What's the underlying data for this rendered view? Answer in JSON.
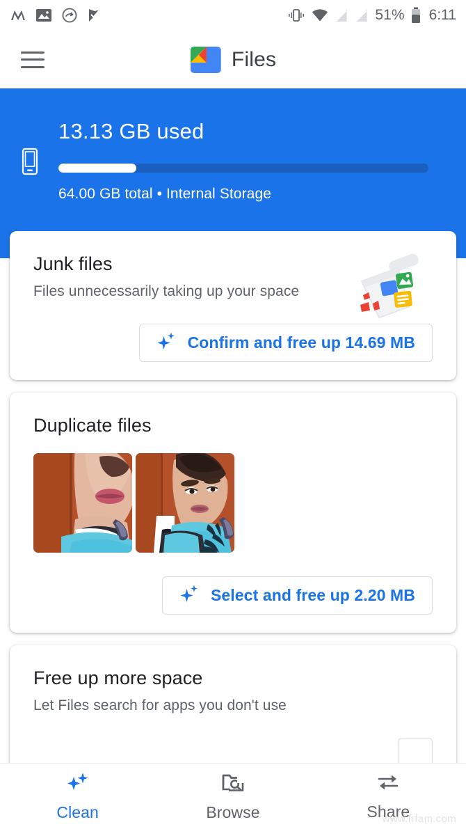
{
  "statusbar": {
    "left_icons": [
      "mountain-peaks-icon",
      "photo-icon",
      "clock-arrow-icon",
      "checkmark-flag-icon"
    ],
    "right_icons": [
      "vibrate-icon",
      "wifi-icon",
      "sim-empty-icon-1",
      "sim-empty-icon-2"
    ],
    "battery_percent": "51%",
    "battery_icon": "battery-icon",
    "time": "6:11"
  },
  "appbar": {
    "menu_icon": "hamburger-menu-icon",
    "logo_icon": "files-app-logo",
    "title": "Files"
  },
  "storage": {
    "device_icon": "phone-icon",
    "used_label": "13.13 GB used",
    "total_label": "64.00 GB total • Internal Storage",
    "used_percent": 21,
    "accent_color": "#1a73e8",
    "track_color": "#1b5fc1"
  },
  "cards": [
    {
      "title": "Junk files",
      "subtitle": "Files unnecessarily taking up your space",
      "illustration": "dustpan-junk-icon",
      "action": {
        "icon": "sparkle-icon",
        "label": "Confirm and free up 14.69 MB"
      }
    },
    {
      "title": "Duplicate files",
      "thumbnails": [
        "duplicate-photo-1",
        "duplicate-photo-2"
      ],
      "action": {
        "icon": "sparkle-icon",
        "label": "Select and free up 2.20 MB"
      }
    },
    {
      "title": "Free up more space",
      "subtitle": "Let Files search for apps you don't use"
    }
  ],
  "bottom_nav": {
    "items": [
      {
        "label": "Clean",
        "icon": "sparkles-icon",
        "active": true
      },
      {
        "label": "Browse",
        "icon": "folder-search-icon",
        "active": false
      },
      {
        "label": "Share",
        "icon": "share-arrows-icon",
        "active": false
      }
    ]
  },
  "watermark": "www.frfam.com"
}
